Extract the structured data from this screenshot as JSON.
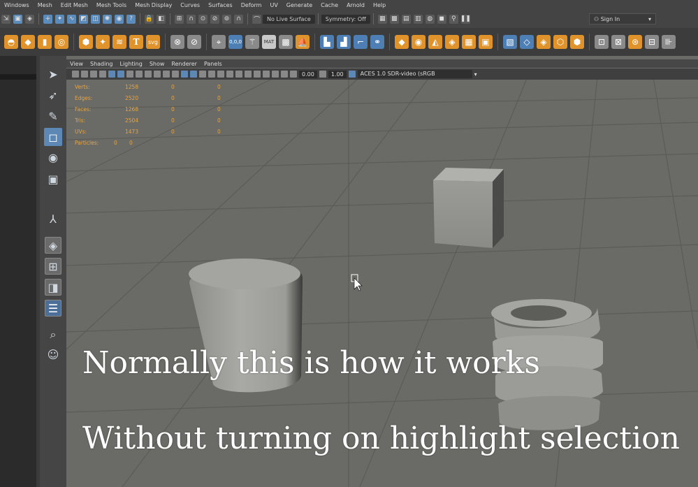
{
  "menubar": {
    "items": [
      "Windows",
      "Mesh",
      "Edit Mesh",
      "Mesh Tools",
      "Mesh Display",
      "Curves",
      "Surfaces",
      "Deform",
      "UV",
      "Generate",
      "Cache",
      "Arnold",
      "Help"
    ]
  },
  "statusline": {
    "live_surface": "No Live Surface",
    "symmetry": "Symmetry: Off",
    "sign_in": "Sign In"
  },
  "shelf": {
    "text_tool": "T",
    "svg_tool": "svg",
    "mat_badge": "MAT",
    "coords": "0,0,0"
  },
  "viewport": {
    "menu": [
      "View",
      "Shading",
      "Lighting",
      "Show",
      "Renderer",
      "Panels"
    ],
    "field_a": "0.00",
    "field_b": "1.00",
    "color_space": "ACES 1.0 SDR-video (sRGB"
  },
  "hud": {
    "rows": [
      {
        "name": "Verts:",
        "a": "1258",
        "b": "0",
        "c": "0"
      },
      {
        "name": "Edges:",
        "a": "2520",
        "b": "0",
        "c": "0"
      },
      {
        "name": "Faces:",
        "a": "1268",
        "b": "0",
        "c": "0"
      },
      {
        "name": "Tris:",
        "a": "2504",
        "b": "0",
        "c": "0"
      },
      {
        "name": "UVs:",
        "a": "1473",
        "b": "0",
        "c": "0"
      },
      {
        "name": "Particles:",
        "a": "0",
        "b": "0",
        "c": ""
      }
    ]
  },
  "captions": {
    "line1": "Normally this is how it works",
    "line2": "Without turning on highlight selection"
  },
  "colors": {
    "accent": "#5d87b4",
    "shelf_orange": "#e0932b",
    "hud_text": "#e2a64a",
    "viewport_bg": "#6a6a66"
  }
}
